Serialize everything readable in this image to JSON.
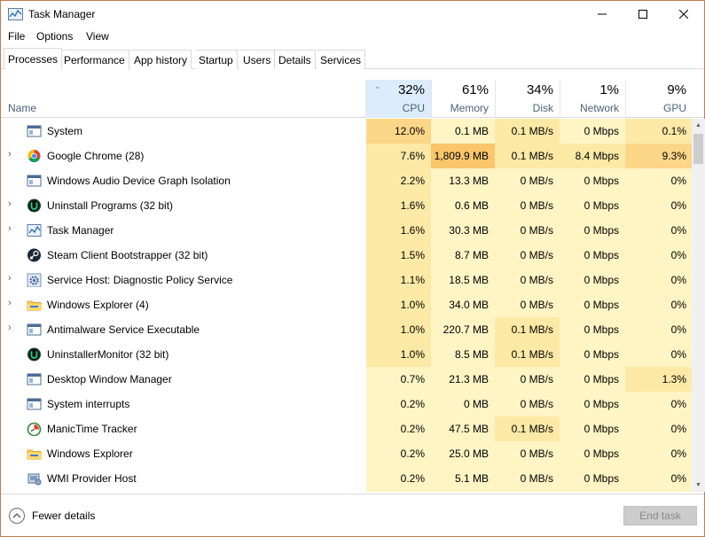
{
  "window": {
    "title": "Task Manager"
  },
  "menu": [
    "File",
    "Options",
    "View"
  ],
  "tabs": [
    "Processes",
    "Performance",
    "App history",
    "Startup",
    "Users",
    "Details",
    "Services"
  ],
  "columns": {
    "name": "Name",
    "cpu": {
      "percent": "32%",
      "label": "CPU"
    },
    "memory": {
      "percent": "61%",
      "label": "Memory"
    },
    "disk": {
      "percent": "34%",
      "label": "Disk"
    },
    "network": {
      "percent": "1%",
      "label": "Network"
    },
    "gpu": {
      "percent": "9%",
      "label": "GPU"
    }
  },
  "processes": [
    {
      "name": "System",
      "icon": "system-window-icon",
      "expandable": false,
      "cpu": "12.0%",
      "memory": "0.1 MB",
      "disk": "0.1 MB/s",
      "network": "0 Mbps",
      "gpu": "0.1%"
    },
    {
      "name": "Google Chrome (28)",
      "icon": "chrome-icon",
      "expandable": true,
      "cpu": "7.6%",
      "memory": "1,809.9 MB",
      "disk": "0.1 MB/s",
      "network": "8.4 Mbps",
      "gpu": "9.3%"
    },
    {
      "name": "Windows Audio Device Graph Isolation",
      "icon": "system-window-icon",
      "expandable": false,
      "cpu": "2.2%",
      "memory": "13.3 MB",
      "disk": "0 MB/s",
      "network": "0 Mbps",
      "gpu": "0%"
    },
    {
      "name": "Uninstall Programs (32 bit)",
      "icon": "uninstaller-icon",
      "expandable": true,
      "cpu": "1.6%",
      "memory": "0.6 MB",
      "disk": "0 MB/s",
      "network": "0 Mbps",
      "gpu": "0%"
    },
    {
      "name": "Task Manager",
      "icon": "task-manager-icon",
      "expandable": true,
      "cpu": "1.6%",
      "memory": "30.3 MB",
      "disk": "0 MB/s",
      "network": "0 Mbps",
      "gpu": "0%"
    },
    {
      "name": "Steam Client Bootstrapper (32 bit)",
      "icon": "steam-icon",
      "expandable": false,
      "cpu": "1.5%",
      "memory": "8.7 MB",
      "disk": "0 MB/s",
      "network": "0 Mbps",
      "gpu": "0%"
    },
    {
      "name": "Service Host: Diagnostic Policy Service",
      "icon": "gear-icon",
      "expandable": true,
      "cpu": "1.1%",
      "memory": "18.5 MB",
      "disk": "0 MB/s",
      "network": "0 Mbps",
      "gpu": "0%"
    },
    {
      "name": "Windows Explorer (4)",
      "icon": "folder-icon",
      "expandable": true,
      "cpu": "1.0%",
      "memory": "34.0 MB",
      "disk": "0 MB/s",
      "network": "0 Mbps",
      "gpu": "0%"
    },
    {
      "name": "Antimalware Service Executable",
      "icon": "system-window-icon",
      "expandable": true,
      "cpu": "1.0%",
      "memory": "220.7 MB",
      "disk": "0.1 MB/s",
      "network": "0 Mbps",
      "gpu": "0%"
    },
    {
      "name": "UninstallerMonitor (32 bit)",
      "icon": "uninstaller-icon",
      "expandable": false,
      "cpu": "1.0%",
      "memory": "8.5 MB",
      "disk": "0.1 MB/s",
      "network": "0 Mbps",
      "gpu": "0%"
    },
    {
      "name": "Desktop Window Manager",
      "icon": "system-window-icon",
      "expandable": false,
      "cpu": "0.7%",
      "memory": "21.3 MB",
      "disk": "0 MB/s",
      "network": "0 Mbps",
      "gpu": "1.3%"
    },
    {
      "name": "System interrupts",
      "icon": "system-window-icon",
      "expandable": false,
      "cpu": "0.2%",
      "memory": "0 MB",
      "disk": "0 MB/s",
      "network": "0 Mbps",
      "gpu": "0%"
    },
    {
      "name": "ManicTime Tracker",
      "icon": "manictime-icon",
      "expandable": false,
      "cpu": "0.2%",
      "memory": "47.5 MB",
      "disk": "0.1 MB/s",
      "network": "0 Mbps",
      "gpu": "0%"
    },
    {
      "name": "Windows Explorer",
      "icon": "folder-icon",
      "expandable": false,
      "cpu": "0.2%",
      "memory": "25.0 MB",
      "disk": "0 MB/s",
      "network": "0 Mbps",
      "gpu": "0%"
    },
    {
      "name": "WMI Provider Host",
      "icon": "wmi-host-icon",
      "expandable": false,
      "cpu": "0.2%",
      "memory": "5.1 MB",
      "disk": "0 MB/s",
      "network": "0 Mbps",
      "gpu": "0%"
    }
  ],
  "heat_colors": {
    "low": "#fff4c4",
    "mid": "#fde9a6",
    "high": "#fcd688",
    "max": "#f9c66c"
  },
  "footer": {
    "fewer_details": "Fewer details",
    "end_task": "End task"
  }
}
